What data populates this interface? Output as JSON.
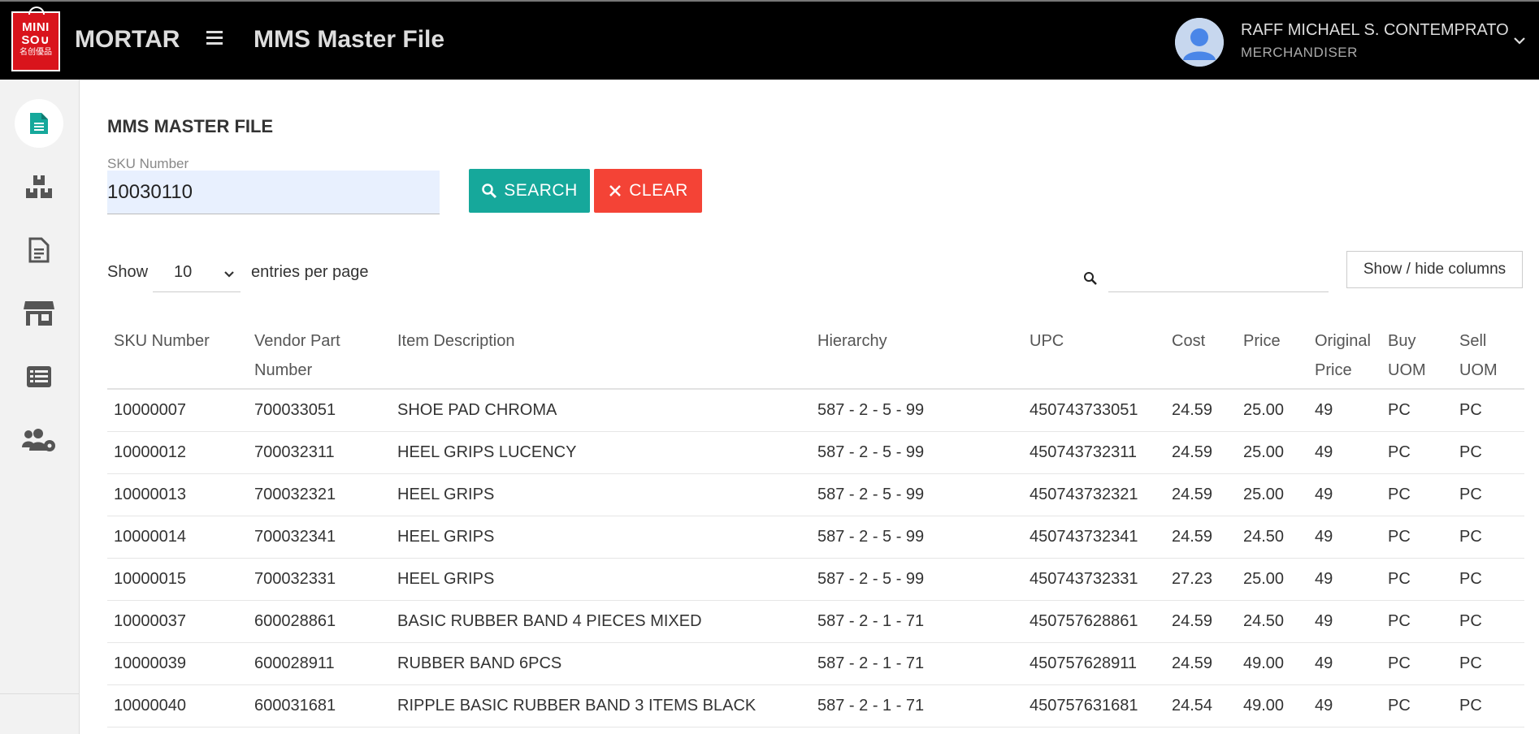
{
  "header": {
    "logo_line1": "MINI",
    "logo_line2": "SO∪",
    "logo_line3": "名创優品",
    "app_name": "MORTAR",
    "menu_icon": "hamburger-icon",
    "page_name": "MMS Master File",
    "user_name": "RAFF MICHAEL S. CONTEMPRATO",
    "user_role": "MERCHANDISER"
  },
  "sidebar": {
    "items": [
      {
        "icon": "document-icon",
        "active": true
      },
      {
        "icon": "boxes-icon",
        "active": false
      },
      {
        "icon": "report-icon",
        "active": false
      },
      {
        "icon": "store-icon",
        "active": false
      },
      {
        "icon": "list-icon",
        "active": false
      },
      {
        "icon": "users-settings-icon",
        "active": false
      }
    ]
  },
  "main": {
    "title": "MMS MASTER FILE",
    "sku_label": "SKU Number",
    "sku_value": "10030110",
    "search_label": "SEARCH",
    "clear_label": "CLEAR",
    "show_label": "Show",
    "entries_value": "10",
    "entries_label": "entries per page",
    "columns_button": "Show / hide columns"
  },
  "table": {
    "columns": [
      {
        "line1": "SKU Number",
        "line2": ""
      },
      {
        "line1": "Vendor Part",
        "line2": "Number"
      },
      {
        "line1": "Item Description",
        "line2": ""
      },
      {
        "line1": "Hierarchy",
        "line2": ""
      },
      {
        "line1": "UPC",
        "line2": ""
      },
      {
        "line1": "Cost",
        "line2": ""
      },
      {
        "line1": "Price",
        "line2": ""
      },
      {
        "line1": "Original",
        "line2": "Price"
      },
      {
        "line1": "Buy",
        "line2": "UOM"
      },
      {
        "line1": "Sell",
        "line2": "UOM"
      }
    ],
    "rows": [
      [
        "10000007",
        "700033051",
        "SHOE PAD CHROMA",
        "587 - 2 - 5 - 99",
        "450743733051",
        "24.59",
        "25.00",
        "49",
        "PC",
        "PC"
      ],
      [
        "10000012",
        "700032311",
        "HEEL GRIPS LUCENCY",
        "587 - 2 - 5 - 99",
        "450743732311",
        "24.59",
        "25.00",
        "49",
        "PC",
        "PC"
      ],
      [
        "10000013",
        "700032321",
        "HEEL GRIPS",
        "587 - 2 - 5 - 99",
        "450743732321",
        "24.59",
        "25.00",
        "49",
        "PC",
        "PC"
      ],
      [
        "10000014",
        "700032341",
        "HEEL GRIPS",
        "587 - 2 - 5 - 99",
        "450743732341",
        "24.59",
        "24.50",
        "49",
        "PC",
        "PC"
      ],
      [
        "10000015",
        "700032331",
        "HEEL GRIPS",
        "587 - 2 - 5 - 99",
        "450743732331",
        "27.23",
        "25.00",
        "49",
        "PC",
        "PC"
      ],
      [
        "10000037",
        "600028861",
        "BASIC RUBBER BAND 4 PIECES MIXED",
        "587 - 2 - 1 - 71",
        "450757628861",
        "24.59",
        "24.50",
        "49",
        "PC",
        "PC"
      ],
      [
        "10000039",
        "600028911",
        "RUBBER BAND 6PCS",
        "587 - 2 - 1 - 71",
        "450757628911",
        "24.59",
        "49.00",
        "49",
        "PC",
        "PC"
      ],
      [
        "10000040",
        "600031681",
        "RIPPLE BASIC RUBBER BAND 3 ITEMS BLACK",
        "587 - 2 - 1 - 71",
        "450757631681",
        "24.54",
        "49.00",
        "49",
        "PC",
        "PC"
      ]
    ]
  },
  "colors": {
    "topbar": "#000000",
    "search_button": "#16a89b",
    "clear_button": "#f44336",
    "active_nav": "#16a89b",
    "input_bg": "#e8f0fe"
  }
}
